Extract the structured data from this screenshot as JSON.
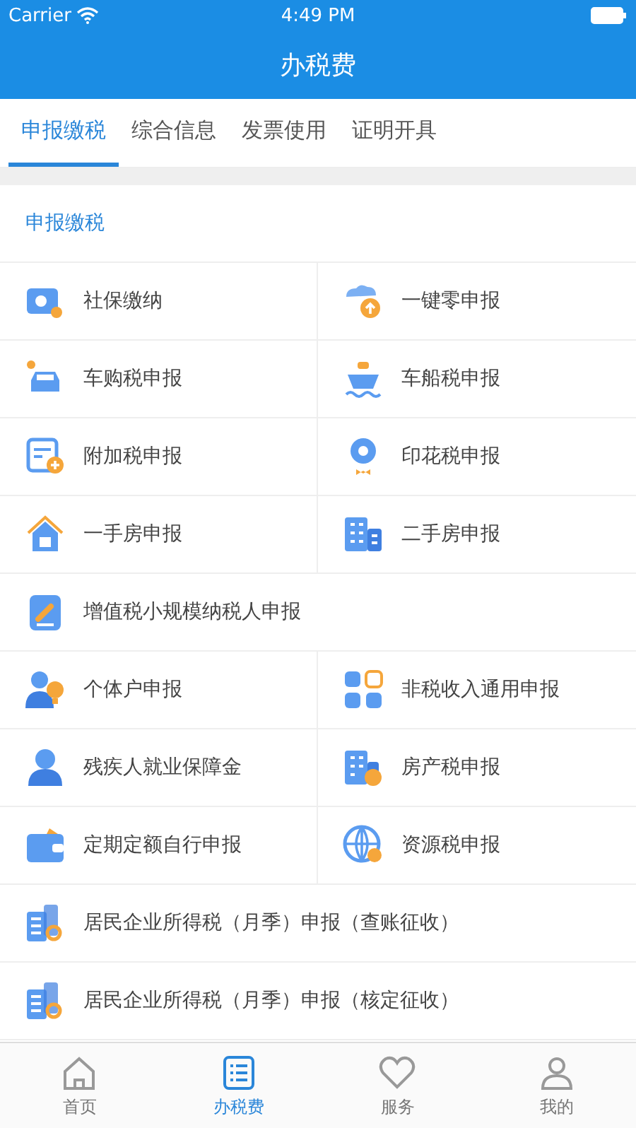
{
  "status_bar": {
    "carrier": "Carrier",
    "time": "4:49 PM"
  },
  "nav_bar": {
    "title": "办税费"
  },
  "tabs": [
    {
      "label": "申报缴税",
      "selected": true
    },
    {
      "label": "综合信息",
      "selected": false
    },
    {
      "label": "发票使用",
      "selected": false
    },
    {
      "label": "证明开具",
      "selected": false
    }
  ],
  "section": {
    "title": "申报缴税"
  },
  "items": [
    {
      "label": "社保缴纳",
      "kind": "half"
    },
    {
      "label": "一键零申报",
      "kind": "half"
    },
    {
      "label": "车购税申报",
      "kind": "half"
    },
    {
      "label": "车船税申报",
      "kind": "half"
    },
    {
      "label": "附加税申报",
      "kind": "half"
    },
    {
      "label": "印花税申报",
      "kind": "half"
    },
    {
      "label": "一手房申报",
      "kind": "half"
    },
    {
      "label": "二手房申报",
      "kind": "half"
    },
    {
      "label": "增值税小规模纳税人申报",
      "kind": "wide"
    },
    {
      "label": "个体户申报",
      "kind": "half"
    },
    {
      "label": "非税收入通用申报",
      "kind": "half"
    },
    {
      "label": "残疾人就业保障金",
      "kind": "half"
    },
    {
      "label": "房产税申报",
      "kind": "half"
    },
    {
      "label": "定期定额自行申报",
      "kind": "half"
    },
    {
      "label": "资源税申报",
      "kind": "half"
    },
    {
      "label": "居民企业所得税（月季）申报（查账征收）",
      "kind": "wide"
    },
    {
      "label": "居民企业所得税（月季）申报（核定征收）",
      "kind": "wide"
    }
  ],
  "bottom_tabs": [
    {
      "label": "首页",
      "selected": false
    },
    {
      "label": "办税费",
      "selected": true
    },
    {
      "label": "服务",
      "selected": false
    },
    {
      "label": "我的",
      "selected": false
    }
  ]
}
